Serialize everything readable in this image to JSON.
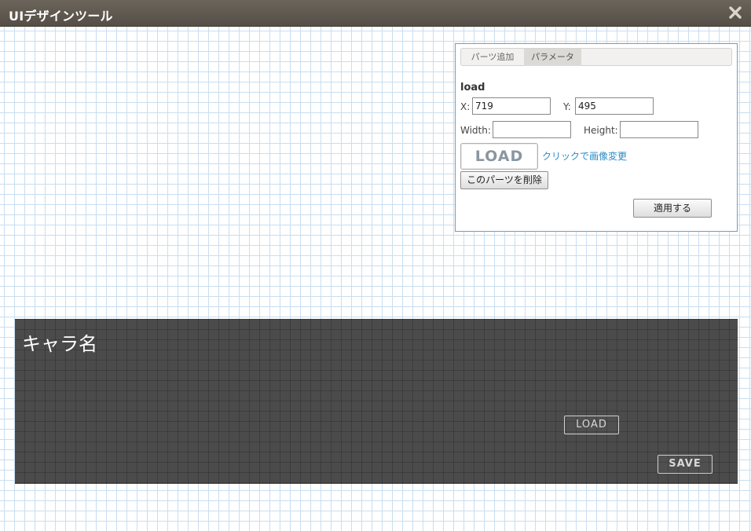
{
  "window": {
    "title": "UIデザインツール",
    "close_icon": "close-x-icon"
  },
  "panel": {
    "tabs": [
      {
        "label": "パーツ追加",
        "active": false
      },
      {
        "label": "パラメータ",
        "active": true
      }
    ],
    "part_name": "load",
    "x_label": "X:",
    "x_value": "719",
    "y_label": "Y:",
    "y_value": "495",
    "width_label": "Width:",
    "width_value": "",
    "height_label": "Height:",
    "height_value": "",
    "image_preview_text": "LOAD",
    "change_image_link": "クリックで画像変更",
    "delete_button": "このパーツを削除",
    "apply_button": "適用する"
  },
  "canvas": {
    "character_name": "キャラ名",
    "load_button": "LOAD",
    "save_button": "SAVE"
  },
  "colors": {
    "titlebar": "#5f5950",
    "canvas_bg": "#4b4b4b",
    "link": "#2b8ac4",
    "grid_line": "#c9def0"
  }
}
